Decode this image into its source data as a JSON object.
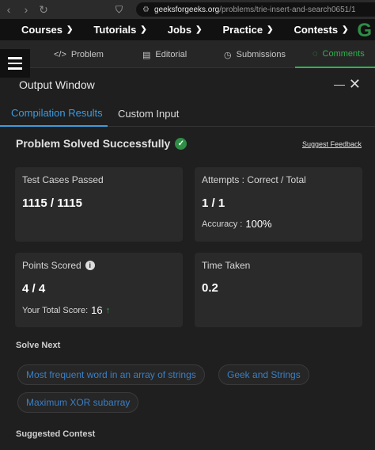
{
  "browser": {
    "url_domain": "geeksforgeeks.org",
    "url_path": "/problems/trie-insert-and-search0651/1"
  },
  "site_nav": {
    "items": [
      {
        "label": "Courses"
      },
      {
        "label": "Tutorials"
      },
      {
        "label": "Jobs"
      },
      {
        "label": "Practice"
      },
      {
        "label": "Contests"
      }
    ],
    "logo": "G"
  },
  "problem_tabs": [
    {
      "label": "Problem",
      "icon": "code-icon",
      "glyph": "</>"
    },
    {
      "label": "Editorial",
      "icon": "document-icon",
      "glyph": "▤"
    },
    {
      "label": "Submissions",
      "icon": "clock-icon",
      "glyph": "◷"
    },
    {
      "label": "Comments",
      "icon": "comment-icon",
      "glyph": "◌",
      "active": true
    }
  ],
  "output": {
    "title": "Output Window",
    "minimize": "—",
    "close": "✕"
  },
  "result_tabs": [
    {
      "label": "Compilation Results",
      "active": true
    },
    {
      "label": "Custom Input"
    }
  ],
  "status": {
    "text": "Problem Solved Successfully",
    "feedback": "Suggest Feedback"
  },
  "cards": {
    "test_cases": {
      "label": "Test Cases Passed",
      "value": "1115 / 1115"
    },
    "attempts": {
      "label": "Attempts : Correct / Total",
      "value": "1 / 1",
      "accuracy_label": "Accuracy :",
      "accuracy_value": "100%"
    },
    "points": {
      "label": "Points Scored",
      "value": "4 / 4",
      "total_label": "Your Total Score:",
      "total_value": "16"
    },
    "time": {
      "label": "Time Taken",
      "value": "0.2"
    }
  },
  "solve_next": {
    "title": "Solve Next",
    "items": [
      {
        "label": "Most frequent word in an array of strings"
      },
      {
        "label": "Geek and Strings"
      },
      {
        "label": "Maximum XOR subarray"
      }
    ]
  },
  "suggested": {
    "title": "Suggested Contest"
  },
  "colors": {
    "accent_green": "#2fb34e",
    "accent_blue": "#3b9be0",
    "background": "#1f1f1f",
    "card": "#2a2a2a"
  }
}
